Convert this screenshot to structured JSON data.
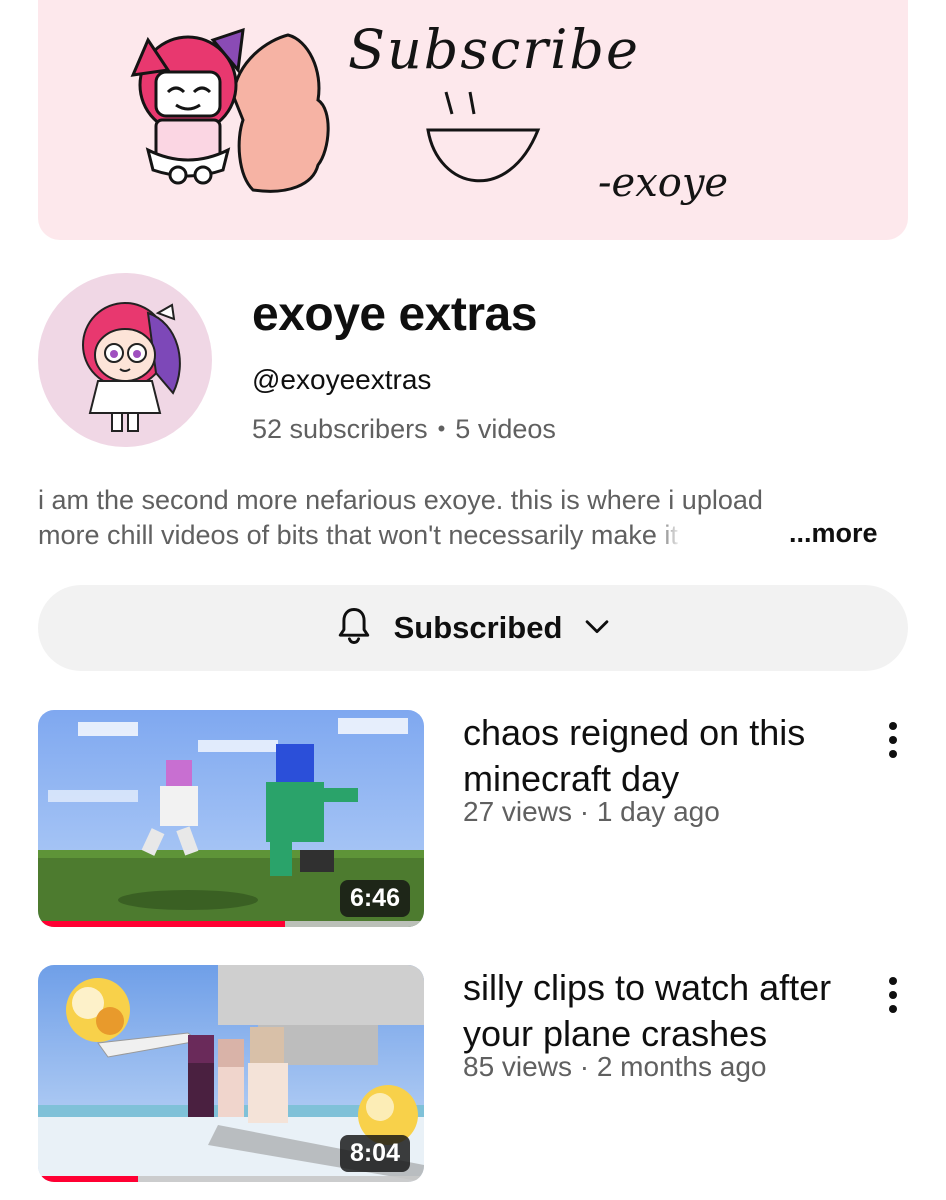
{
  "banner": {
    "headline": "Subscribe",
    "signature": "-exoye"
  },
  "channel": {
    "name": "exoye extras",
    "handle": "@exoyeextras",
    "subscribers": "52 subscribers",
    "videos": "5 videos",
    "stats_separator": "•"
  },
  "description": {
    "line1": "i am the second more nefarious exoye. this is where i upload",
    "line2": "more chill videos of bits that won't necessarily make",
    "line2_faded": " it",
    "more_label": "...more"
  },
  "subscribe_button": {
    "label": "Subscribed",
    "icon": "bell-icon",
    "chevron": "chevron-down-icon"
  },
  "videos": [
    {
      "title": "chaos reigned on this minecraft day",
      "meta": "27 views · 1 day ago",
      "duration": "6:46",
      "watch_progress": 0.64
    },
    {
      "title": "silly clips to watch after your plane crashes",
      "meta": "85 views · 2 months ago",
      "duration": "8:04",
      "watch_progress": 0.26
    }
  ],
  "colors": {
    "banner_bg": "#fde8ec",
    "avatar_bg": "#f0d7e5",
    "progress": "#ff0033",
    "button_bg": "#f2f2f2",
    "secondary_text": "#606060"
  }
}
